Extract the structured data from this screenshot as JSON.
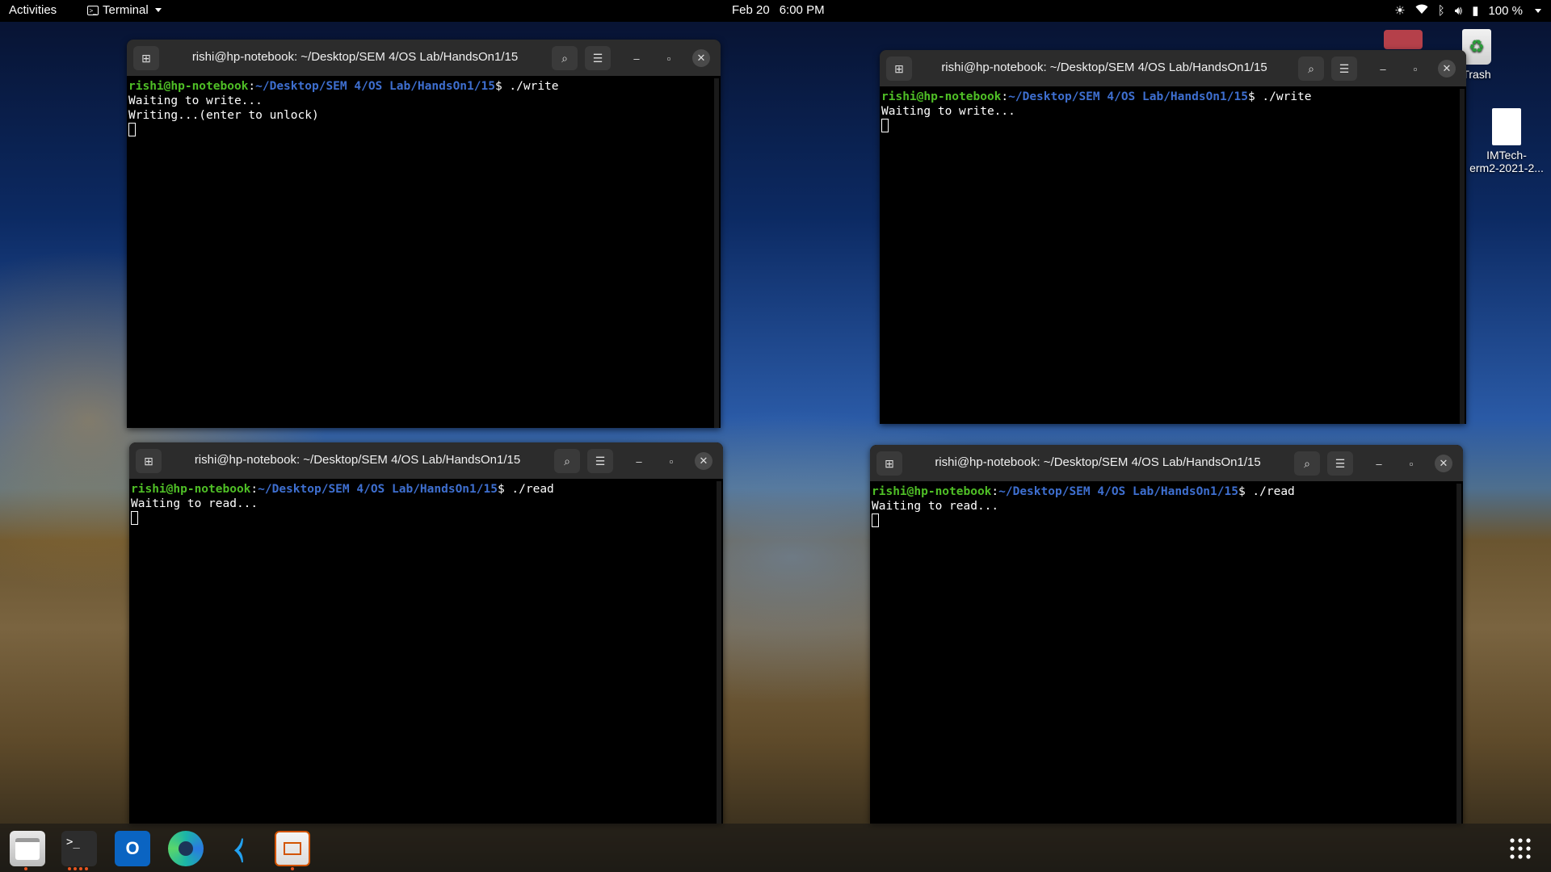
{
  "topbar": {
    "activities": "Activities",
    "app_name": "Terminal",
    "date": "Feb 20",
    "time": "6:00 PM",
    "battery": "100 %"
  },
  "desktop": {
    "trash_label": "Trash",
    "file_label_line1": "IMTech-",
    "file_label_line2": "erm2-2021-2..."
  },
  "terminals": [
    {
      "title": "rishi@hp-notebook: ~/Desktop/SEM 4/OS Lab/HandsOn1/15",
      "user": "rishi@hp-notebook",
      "path": "~/Desktop/SEM 4/OS Lab/HandsOn1/15",
      "command": "$ ./write",
      "line1": "Waiting to write...",
      "line2": "Writing...(enter to unlock)"
    },
    {
      "title": "rishi@hp-notebook: ~/Desktop/SEM 4/OS Lab/HandsOn1/15",
      "user": "rishi@hp-notebook",
      "path": "~/Desktop/SEM 4/OS Lab/HandsOn1/15",
      "command": "$ ./write",
      "line1": "Waiting to write...",
      "line2": ""
    },
    {
      "title": "rishi@hp-notebook: ~/Desktop/SEM 4/OS Lab/HandsOn1/15",
      "user": "rishi@hp-notebook",
      "path": "~/Desktop/SEM 4/OS Lab/HandsOn1/15",
      "command": "$ ./read",
      "line1": "Waiting to read...",
      "line2": ""
    },
    {
      "title": "rishi@hp-notebook: ~/Desktop/SEM 4/OS Lab/HandsOn1/15",
      "user": "rishi@hp-notebook",
      "path": "~/Desktop/SEM 4/OS Lab/HandsOn1/15",
      "command": "$ ./read",
      "line1": "Waiting to read...",
      "line2": ""
    }
  ],
  "colors": {
    "prompt_user": "#4fbf26",
    "prompt_path": "#3e6fd0",
    "accent": "#e95420"
  },
  "dock": {
    "apps": [
      "files-icon",
      "terminal-icon",
      "outlook-icon",
      "edge-icon",
      "vscode-icon",
      "impress-icon"
    ],
    "grid": "show-applications-icon"
  }
}
